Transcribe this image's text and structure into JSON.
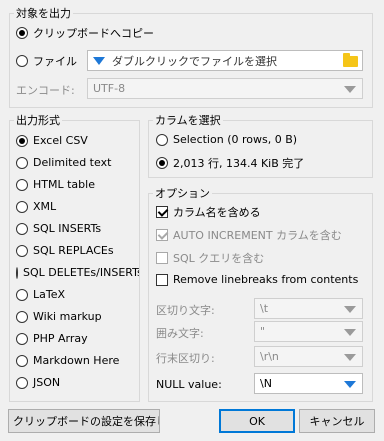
{
  "output_target": {
    "legend": "対象を出力",
    "clipboard_label": "クリップボードへコピー",
    "file_label": "ファイル",
    "file_placeholder": "ダブルクリックでファイルを選択",
    "encoding_label": "エンコード:",
    "encoding_value": "UTF-8",
    "selected": "clipboard"
  },
  "format": {
    "legend": "出力形式",
    "options": [
      "Excel CSV",
      "Delimited text",
      "HTML table",
      "XML",
      "SQL INSERTs",
      "SQL REPLACEs",
      "SQL DELETEs/INSERTs",
      "LaTeX",
      "Wiki markup",
      "PHP Array",
      "Markdown Here",
      "JSON"
    ],
    "selected": "Excel CSV"
  },
  "columns": {
    "legend": "カラムを選択",
    "selection_label": "Selection (0 rows, 0 B)",
    "complete_label": "2,013 行, 134.4 KiB 完了",
    "selected": "complete"
  },
  "options": {
    "legend": "オプション",
    "include_column_names": "カラム名を含める",
    "auto_increment": "AUTO INCREMENT カラムを含む",
    "sql_query": "SQL クエリを含む",
    "remove_linebreaks": "Remove linebreaks from contents",
    "field_sep_label": "区切り文字:",
    "field_sep_value": "\\t",
    "encloser_label": "囲み文字:",
    "encloser_value": "\"",
    "line_term_label": "行末区切り:",
    "line_term_value": "\\r\\n",
    "null_label": "NULL value:",
    "null_value": "\\N"
  },
  "buttons": {
    "save_clipboard": "クリップボードの設定を保存します",
    "ok": "OK",
    "cancel": "キャンセル"
  },
  "colors": {
    "accent": "#0078d7",
    "folder": "#f5c518"
  }
}
